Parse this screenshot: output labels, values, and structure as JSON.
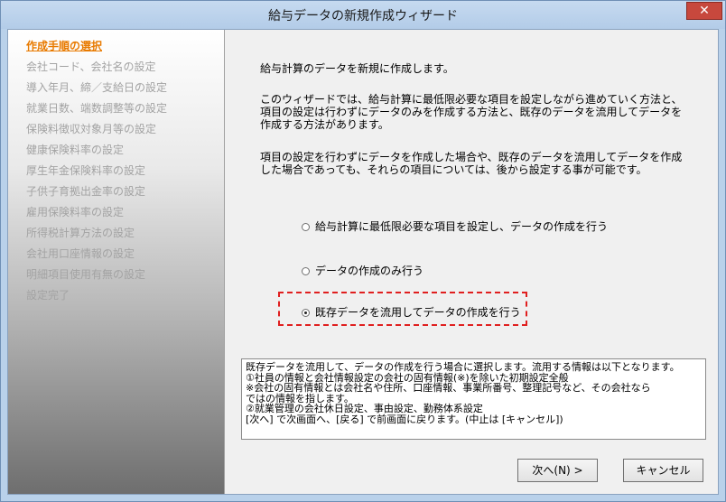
{
  "window": {
    "title": "給与データの新規作成ウィザード",
    "close_glyph": "✕"
  },
  "sidebar": {
    "steps": [
      "作成手順の選択",
      "会社コード、会社名の設定",
      "導入年月、締／支給日の設定",
      "就業日数、端数調整等の設定",
      "保険料徴収対象月等の設定",
      "健康保険料率の設定",
      "厚生年金保険料率の設定",
      "子供子育拠出金率の設定",
      "雇用保険料率の設定",
      "所得税計算方法の設定",
      "会社用口座情報の設定",
      "明細項目使用有無の設定",
      "設定完了"
    ],
    "active_index": 0
  },
  "main": {
    "intro": "給与計算のデータを新規に作成します。",
    "para2": "このウィザードでは、給与計算に最低限必要な項目を設定しながら進めていく方法と、\n項目の設定は行わずにデータのみを作成する方法と、既存のデータを流用してデータを\n作成する方法があります。",
    "para3": "項目の設定を行わずにデータを作成した場合や、既存のデータを流用してデータを作成\nした場合であっても、それらの項目については、後から設定する事が可能です。",
    "options": [
      "給与計算に最低限必要な項目を設定し、データの作成を行う",
      "データの作成のみ行う",
      "既存データを流用してデータの作成を行う"
    ],
    "selected_option": 2,
    "description": "既存データを流用して、データの作成を行う場合に選択します。流用する情報は以下となります。\n①社員の情報と会社情報設定の会社の固有情報(※)を除いた初期設定全般\n※会社の固有情報とは会社名や住所、口座情報、事業所番号、整理記号など、その会社なら\nではの情報を指します。\n②就業管理の会社休日設定、事由設定、勤務体系設定\n[次へ] で次画面へ、[戻る] で前画面に戻ります。(中止は [キャンセル])"
  },
  "buttons": {
    "next": "次へ(N) >",
    "cancel": "キャンセル"
  }
}
